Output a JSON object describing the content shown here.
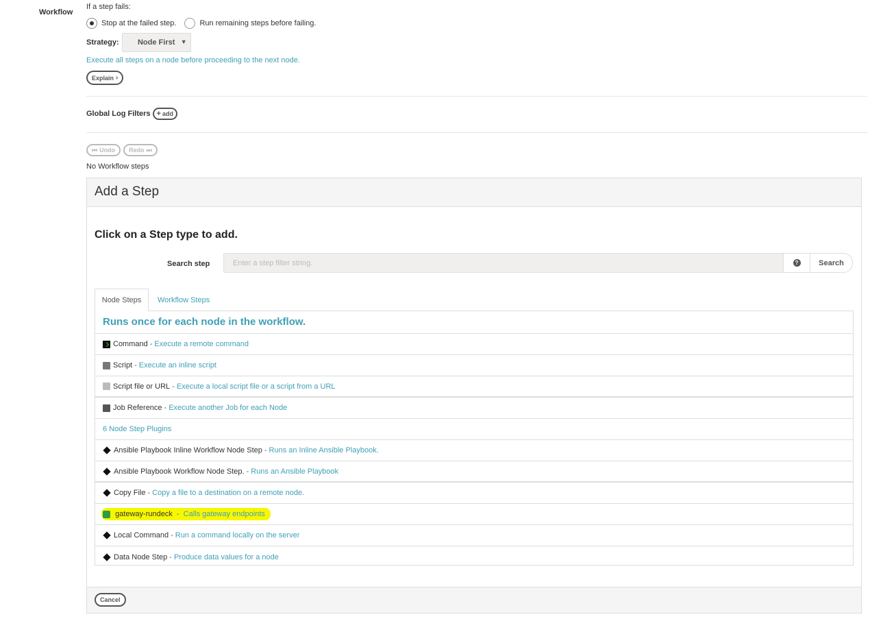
{
  "workflow_label": "Workflow",
  "fail": {
    "label": "If a step fails:",
    "option_stop": "Stop at the failed step.",
    "option_run": "Run remaining steps before failing."
  },
  "strategy": {
    "label": "Strategy:",
    "value": "Node First",
    "description": "Execute all steps on a node before proceeding to the next node.",
    "explain_button": "Explain"
  },
  "global_log_filters": {
    "label": "Global Log Filters",
    "add_button": "add"
  },
  "history": {
    "undo": "Undo",
    "redo": "Redo"
  },
  "no_steps_text": "No Workflow steps",
  "add_step": {
    "title": "Add a Step",
    "instruction": "Click on a Step type to add.",
    "search_label": "Search step",
    "search_placeholder": "Enter a step filter string.",
    "search_value": "",
    "help_icon": "?",
    "search_button": "Search",
    "tabs": [
      {
        "label": "Node Steps",
        "active": true
      },
      {
        "label": "Workflow Steps",
        "active": false
      }
    ],
    "list_heading": "Runs once for each node in the workflow.",
    "steps": [
      {
        "icon": "terminal-icon",
        "name": "Command",
        "description": "Execute a remote command"
      },
      {
        "icon": "script-icon",
        "name": "Script",
        "description": "Execute an inline script"
      },
      {
        "icon": "script-file-icon",
        "name": "Script file or URL",
        "description": "Execute a local script file or a script from a URL"
      },
      {
        "icon": "book-icon",
        "name": "Job Reference",
        "description": "Execute another Job for each Node"
      }
    ],
    "plugins_label": "6 Node Step Plugins",
    "plugins": [
      {
        "icon": "diamond-icon",
        "name": "Ansible Playbook Inline Workflow Node Step",
        "description": "Runs an Inline Ansible Playbook."
      },
      {
        "icon": "diamond-icon",
        "name": "Ansible Playbook Workflow Node Step.",
        "description": "Runs an Ansible Playbook"
      },
      {
        "icon": "diamond-icon",
        "name": "Copy File",
        "description": "Copy a file to a destination on a remote node."
      },
      {
        "icon": "gateway-icon",
        "name": "gateway-rundeck",
        "description": "Calls gateway endpoints",
        "highlighted": true
      },
      {
        "icon": "diamond-icon",
        "name": "Local Command",
        "description": "Run a command locally on the server"
      },
      {
        "icon": "diamond-icon",
        "name": "Data Node Step",
        "description": "Produce data values for a node"
      }
    ],
    "cancel_button": "Cancel"
  },
  "colors": {
    "link": "#3f9fb7",
    "highlight": "#f7f700"
  }
}
